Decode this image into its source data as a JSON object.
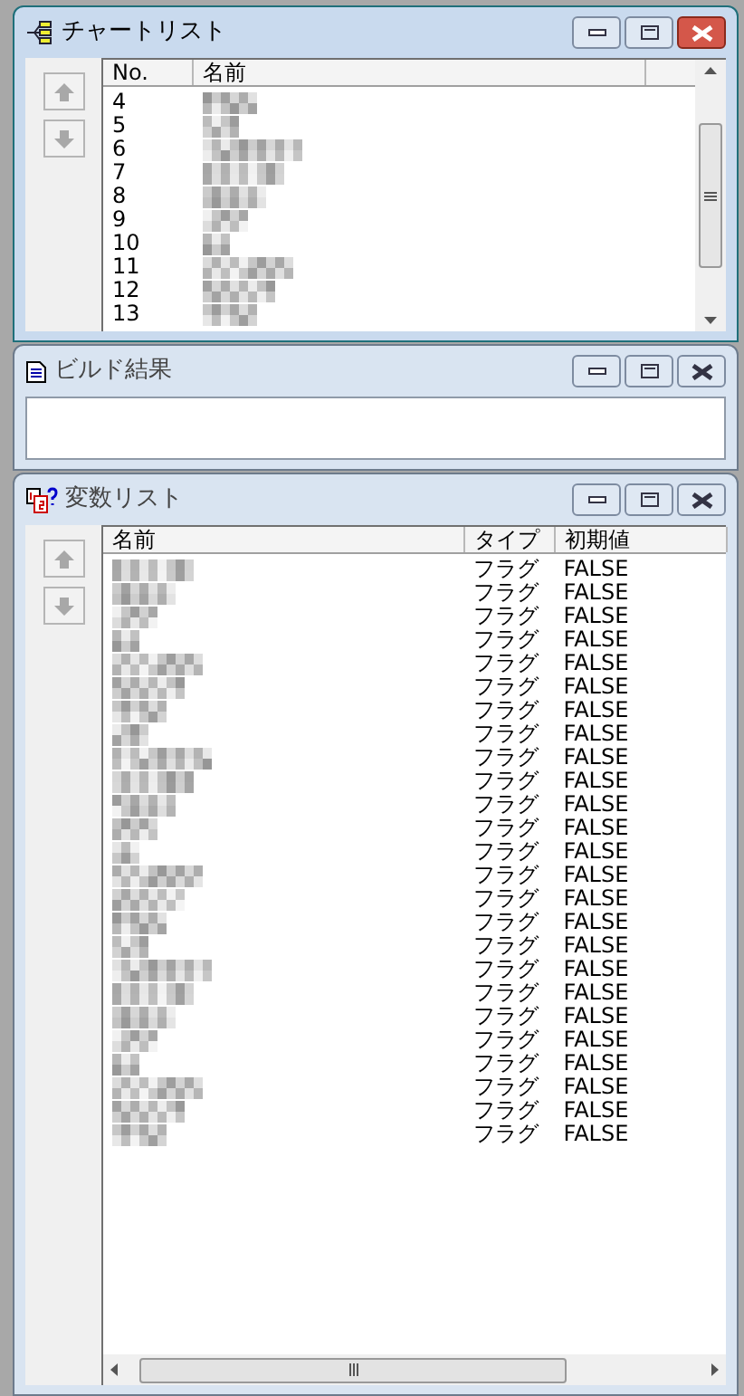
{
  "panels": [
    {
      "kind": "chart_list",
      "title": "チャートリスト",
      "active": true,
      "columns": [
        "No.",
        "名前"
      ],
      "rows": [
        {
          "no": "4"
        },
        {
          "no": "5"
        },
        {
          "no": "6"
        },
        {
          "no": "7"
        },
        {
          "no": "8"
        },
        {
          "no": "9"
        },
        {
          "no": "10"
        },
        {
          "no": "11"
        },
        {
          "no": "12"
        },
        {
          "no": "13"
        }
      ]
    },
    {
      "kind": "build",
      "title": "ビルド結果",
      "active": false
    },
    {
      "kind": "variables",
      "title": "変数リスト",
      "active": false,
      "columns": [
        "名前",
        "タイプ",
        "初期値"
      ],
      "rows": [
        {
          "type": "フラグ",
          "initial": "FALSE"
        },
        {
          "type": "フラグ",
          "initial": "FALSE"
        },
        {
          "type": "フラグ",
          "initial": "FALSE"
        },
        {
          "type": "フラグ",
          "initial": "FALSE"
        },
        {
          "type": "フラグ",
          "initial": "FALSE"
        },
        {
          "type": "フラグ",
          "initial": "FALSE"
        },
        {
          "type": "フラグ",
          "initial": "FALSE"
        },
        {
          "type": "フラグ",
          "initial": "FALSE"
        },
        {
          "type": "フラグ",
          "initial": "FALSE"
        },
        {
          "type": "フラグ",
          "initial": "FALSE"
        },
        {
          "type": "フラグ",
          "initial": "FALSE"
        },
        {
          "type": "フラグ",
          "initial": "FALSE"
        },
        {
          "type": "フラグ",
          "initial": "FALSE"
        },
        {
          "type": "フラグ",
          "initial": "FALSE"
        },
        {
          "type": "フラグ",
          "initial": "FALSE"
        },
        {
          "type": "フラグ",
          "initial": "FALSE"
        },
        {
          "type": "フラグ",
          "initial": "FALSE"
        },
        {
          "type": "フラグ",
          "initial": "FALSE"
        },
        {
          "type": "フラグ",
          "initial": "FALSE"
        },
        {
          "type": "フラグ",
          "initial": "FALSE"
        },
        {
          "type": "フラグ",
          "initial": "FALSE"
        },
        {
          "type": "フラグ",
          "initial": "FALSE"
        },
        {
          "type": "フラグ",
          "initial": "FALSE"
        },
        {
          "type": "フラグ",
          "initial": "FALSE"
        },
        {
          "type": "フラグ",
          "initial": "FALSE"
        }
      ]
    }
  ]
}
